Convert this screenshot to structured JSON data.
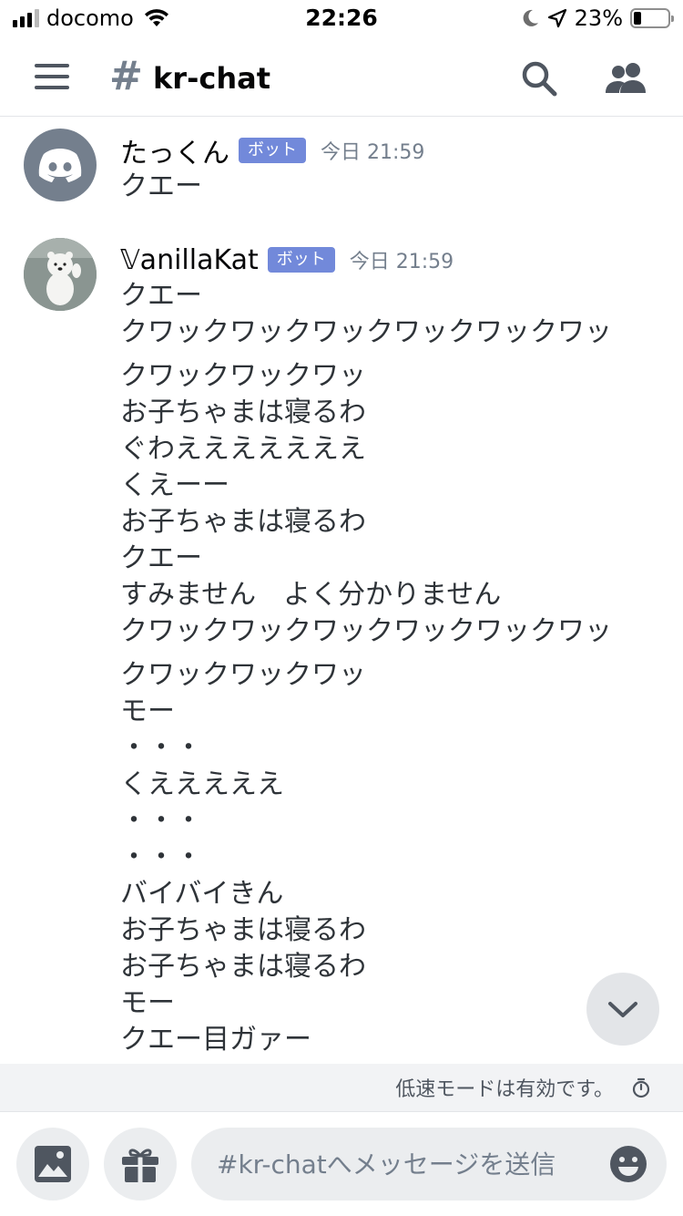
{
  "status_bar": {
    "carrier": "docomo",
    "time": "22:26",
    "battery_percent": "23%"
  },
  "header": {
    "channel_hash": "#",
    "channel_name": "kr-chat"
  },
  "messages": [
    {
      "username": "たっくん",
      "badge": "ボット",
      "timestamp": "今日 21:59",
      "lines": [
        "クエー"
      ]
    },
    {
      "username": "𝕍anillaKat",
      "badge": "ボット",
      "timestamp": "今日 21:59",
      "lines": [
        "クエー",
        "クワックワックワックワックワックワッ",
        "クワックワックワッ",
        "お子ちゃまは寝るわ",
        "ぐわえええええええ",
        "くえーー",
        "お子ちゃまは寝るわ",
        "クエー",
        "すみません　よく分かりません",
        "クワックワックワックワックワックワッ",
        "クワックワックワッ",
        "モー",
        "・・・",
        "くえええええ",
        "・・・",
        "・・・",
        "バイバイきん",
        "お子ちゃまは寝るわ",
        "お子ちゃまは寝るわ",
        "モー",
        "クエー目ガァー"
      ]
    }
  ],
  "slow_mode": {
    "text": "低速モードは有効です。"
  },
  "composer": {
    "placeholder": "#kr-chatへメッセージを送信"
  },
  "colors": {
    "bot_badge": "#7289da",
    "icon_gray": "#4f5660",
    "avatar_discord": "#747f8d"
  }
}
